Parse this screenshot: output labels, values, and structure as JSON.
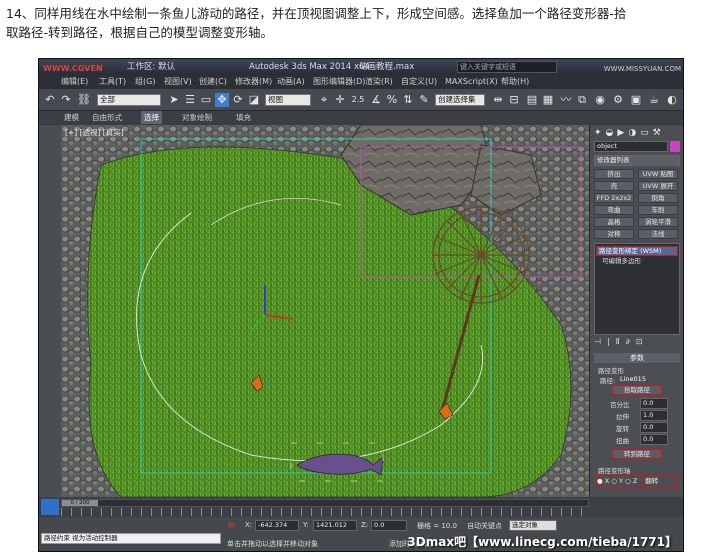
{
  "caption": {
    "line1": "14、同样用线在水中绘制一条鱼儿游动的路径，并在顶视图调整上下，形成空间感。选择鱼加一个路径变形器-拾",
    "line2": "取路径-转到路径，根据自己的模型调整变形轴。"
  },
  "window": {
    "site_tl": "WWW.CGVEN",
    "workspace_label": "工作区: 默认",
    "app_title": "Autodesk 3ds Max  2014 x64",
    "file_name": "动画教程.max",
    "search_placeholder": "键入关键字或短语",
    "site_tr": "WWW.MISSYUAN.COM"
  },
  "menu": [
    "编辑(E)",
    "工具(T)",
    "组(G)",
    "视图(V)",
    "创建(C)",
    "修改器(M)",
    "动画(A)",
    "图形编辑器(D)",
    "渲染(R)",
    "自定义(U)",
    "MAXScript(X)",
    "帮助(H)"
  ],
  "toolbar": {
    "selection_filter": "全部",
    "ref_coord": "视图",
    "snap_value": "2.5",
    "named_sel": "创建选择集"
  },
  "ribbon": {
    "tabs": [
      "建模",
      "自由形式",
      "选择",
      "对象绘制",
      "填充"
    ],
    "active_tab": "选择"
  },
  "viewport": {
    "label": "[+] [透视] [真实]"
  },
  "command_panel": {
    "object_name": "object",
    "modifier_list": "修改器列表",
    "mod_buttons": [
      [
        "挤出",
        "UVW 贴图"
      ],
      [
        "壳",
        "UVW 展开"
      ],
      [
        "FFD 2x2x2",
        "倒角"
      ],
      [
        "弯曲",
        "车削"
      ],
      [
        "晶格",
        "涡轮平滑"
      ],
      [
        "对称",
        "法线"
      ]
    ],
    "stack_items": [
      "路径变形绑定 (WSM)",
      "可编辑多边形"
    ],
    "rollout_title": "参数",
    "path_deform_group": "路径变形",
    "path_label": "路径:",
    "path_value": "Line015",
    "pick_path_button": "拾取路径",
    "params": [
      {
        "label": "百分比",
        "value": "0.0"
      },
      {
        "label": "拉伸",
        "value": "1.0"
      },
      {
        "label": "旋转",
        "value": "0.0"
      },
      {
        "label": "扭曲",
        "value": "0.0"
      }
    ],
    "move_to_path_button": "转到路径",
    "axis_group": "路径变形轴",
    "axes": [
      "X",
      "Y",
      "Z"
    ],
    "selected_axis": "X",
    "flip_label": "翻转"
  },
  "timeline": {
    "frame_counter": "0 / 200"
  },
  "status": {
    "prompt_line": "路径约束  视为活动控制器",
    "coord_x_label": "X:",
    "coord_x": "-642.374",
    "coord_y_label": "Y:",
    "coord_y": "1421.012",
    "coord_z_label": "Z:",
    "coord_z": "0.0",
    "grid": "栅格 = 10.0",
    "auto_key": "自动关键点",
    "selected_set": "选定对象",
    "hint": "单击并拖动以选择并移动对象",
    "add_time_tag": "添加时间标记"
  },
  "watermark": "3Dmax吧【www.linecg.com/tieba/1771】",
  "colors": {
    "highlight_red": "#e01010",
    "grass_green": "#4c8a22",
    "fish_purple": "#6a4f8e"
  }
}
